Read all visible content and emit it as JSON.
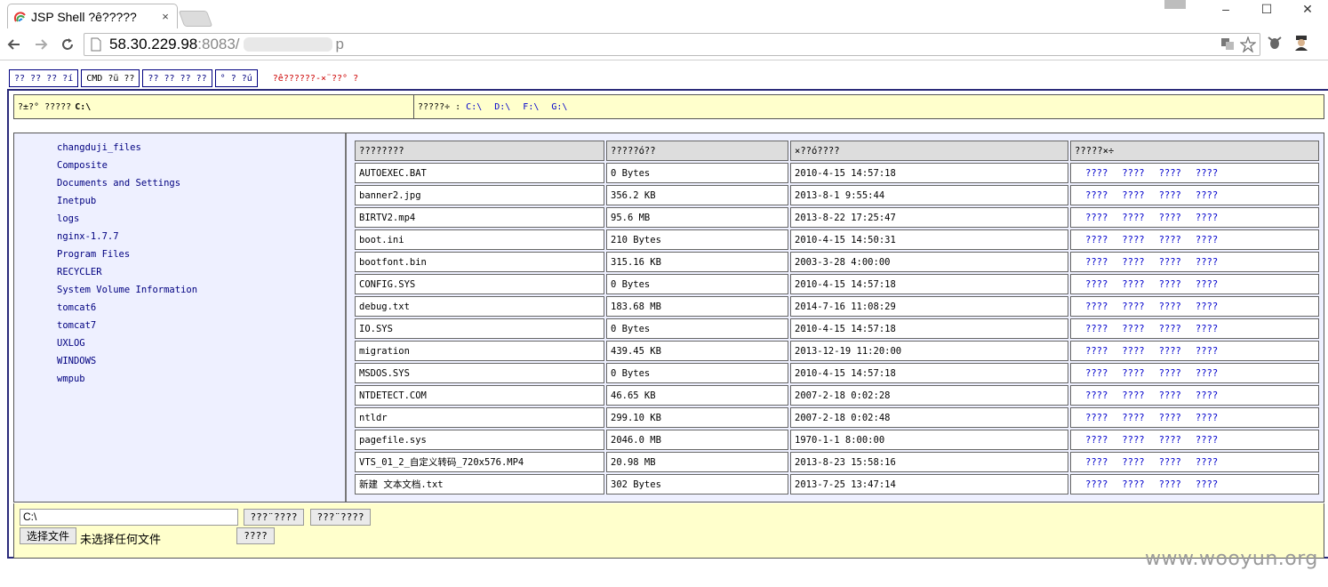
{
  "browser": {
    "tab_title": "JSP Shell ?ê?????",
    "tab_close": "×",
    "url_host": "58.30.229.98",
    "url_port": ":8083/",
    "url_tail": "p",
    "window_controls": [
      "–",
      "☐",
      "✕"
    ]
  },
  "menu": {
    "buttons": [
      "?? ?? ?? ?í",
      "CMD ?ü ??",
      "?? ?? ?? ??",
      "° ? ?ú"
    ],
    "note": "?ê??????-×¨??° ?"
  },
  "pathbar": {
    "label": "?±?° ?????",
    "current": "C:\\",
    "drives_label": "?????÷ :",
    "drives": [
      "C:\\",
      "D:\\",
      "F:\\",
      "G:\\"
    ]
  },
  "dirs": [
    "changduji_files",
    "Composite",
    "Documents and Settings",
    "Inetpub",
    "logs",
    "nginx-1.7.7",
    "Program Files",
    "RECYCLER",
    "System Volume Information",
    "tomcat6",
    "tomcat7",
    "UXLOG",
    "WINDOWS",
    "wmpub"
  ],
  "table": {
    "headers": [
      "????????",
      "?????ó??",
      "×??ó????",
      "?????×÷"
    ],
    "op_labels": [
      "????",
      "????",
      "????",
      "????"
    ],
    "rows": [
      {
        "name": "AUTOEXEC.BAT",
        "size": "0 Bytes",
        "time": "2010-4-15 14:57:18"
      },
      {
        "name": "banner2.jpg",
        "size": "356.2 KB",
        "time": "2013-8-1 9:55:44"
      },
      {
        "name": "BIRTV2.mp4",
        "size": "95.6 MB",
        "time": "2013-8-22 17:25:47"
      },
      {
        "name": "boot.ini",
        "size": "210 Bytes",
        "time": "2010-4-15 14:50:31"
      },
      {
        "name": "bootfont.bin",
        "size": "315.16 KB",
        "time": "2003-3-28 4:00:00"
      },
      {
        "name": "CONFIG.SYS",
        "size": "0 Bytes",
        "time": "2010-4-15 14:57:18"
      },
      {
        "name": "debug.txt",
        "size": "183.68 MB",
        "time": "2014-7-16 11:08:29"
      },
      {
        "name": "IO.SYS",
        "size": "0 Bytes",
        "time": "2010-4-15 14:57:18"
      },
      {
        "name": "migration",
        "size": "439.45 KB",
        "time": "2013-12-19 11:20:00"
      },
      {
        "name": "MSDOS.SYS",
        "size": "0 Bytes",
        "time": "2010-4-15 14:57:18"
      },
      {
        "name": "NTDETECT.COM",
        "size": "46.65 KB",
        "time": "2007-2-18 0:02:28"
      },
      {
        "name": "ntldr",
        "size": "299.10 KB",
        "time": "2007-2-18 0:02:48"
      },
      {
        "name": "pagefile.sys",
        "size": "2046.0 MB",
        "time": "1970-1-1 8:00:00"
      },
      {
        "name": "VTS_01_2_自定义转码_720x576.MP4",
        "size": "20.98 MB",
        "time": "2013-8-23 15:58:16"
      },
      {
        "name": "新建 文本文档.txt",
        "size": "302 Bytes",
        "time": "2013-7-25 13:47:14"
      }
    ]
  },
  "bottom": {
    "path_value": "C:\\",
    "btn1": "???¨????",
    "btn2": "???¨????",
    "choose_file": "选择文件",
    "no_file": "未选择任何文件",
    "upload": "????"
  },
  "watermark": "www.wooyun.org"
}
